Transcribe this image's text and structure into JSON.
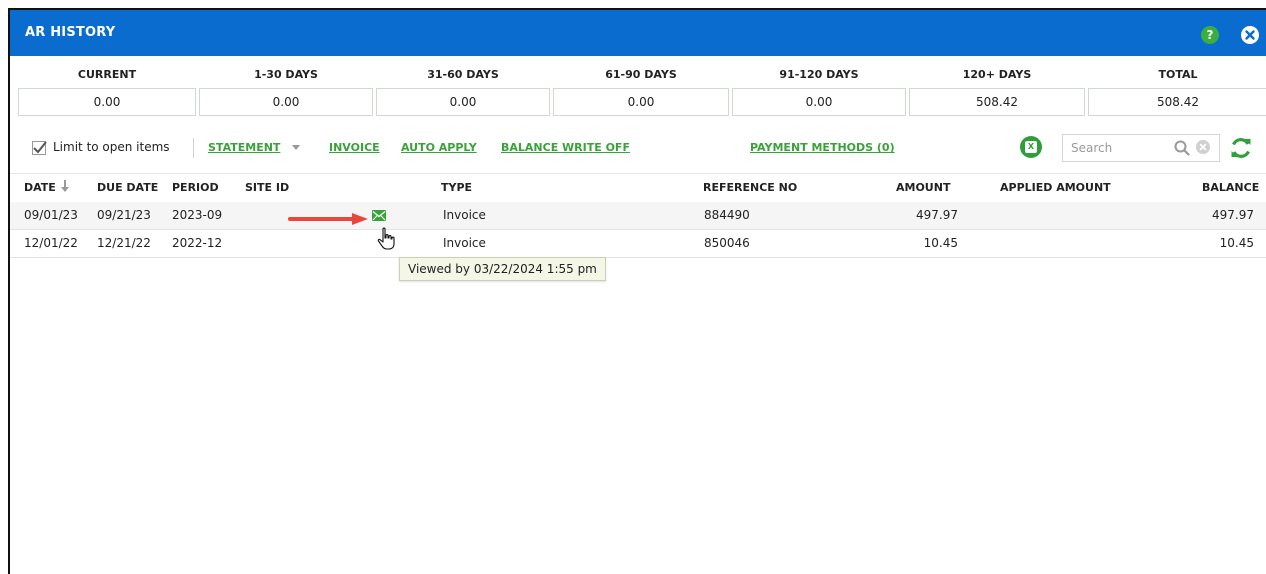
{
  "window": {
    "title": "AR HISTORY",
    "help_symbol": "?"
  },
  "aging": [
    {
      "label": "CURRENT",
      "value": "0.00"
    },
    {
      "label": "1-30 DAYS",
      "value": "0.00"
    },
    {
      "label": "31-60 DAYS",
      "value": "0.00"
    },
    {
      "label": "61-90 DAYS",
      "value": "0.00"
    },
    {
      "label": "91-120 DAYS",
      "value": "0.00"
    },
    {
      "label": "120+ DAYS",
      "value": "508.42"
    },
    {
      "label": "TOTAL",
      "value": "508.42"
    }
  ],
  "toolbar": {
    "limit_label": "Limit to open items",
    "limit_checked": true,
    "statement": "STATEMENT",
    "invoice": "INVOICE",
    "auto_apply": "AUTO APPLY",
    "balance_write_off": "BALANCE WRITE OFF",
    "payment_methods": "PAYMENT METHODS (0)",
    "search_placeholder": "Search"
  },
  "columns": {
    "date": "DATE",
    "due_date": "DUE DATE",
    "period": "PERIOD",
    "site_id": "SITE ID",
    "type": "TYPE",
    "reference_no": "REFERENCE NO",
    "amount": "AMOUNT",
    "applied_amount": "APPLIED AMOUNT",
    "balance": "BALANCE"
  },
  "rows": [
    {
      "date": "09/01/23",
      "due_date": "09/21/23",
      "period": "2023-09",
      "site_id": "",
      "type": "Invoice",
      "reference_no": "884490",
      "amount": "497.97",
      "applied_amount": "",
      "balance": "497.97"
    },
    {
      "date": "12/01/22",
      "due_date": "12/21/22",
      "period": "2022-12",
      "site_id": "",
      "type": "Invoice",
      "reference_no": "850046",
      "amount": "10.45",
      "applied_amount": "",
      "balance": "10.45"
    }
  ],
  "tooltip": "Viewed by 03/22/2024 1:55 pm",
  "colors": {
    "header_blue": "#0a6ccf",
    "link_green": "#3aa23a",
    "help_green": "#3cae3f",
    "arrow_red": "#e8483b"
  }
}
